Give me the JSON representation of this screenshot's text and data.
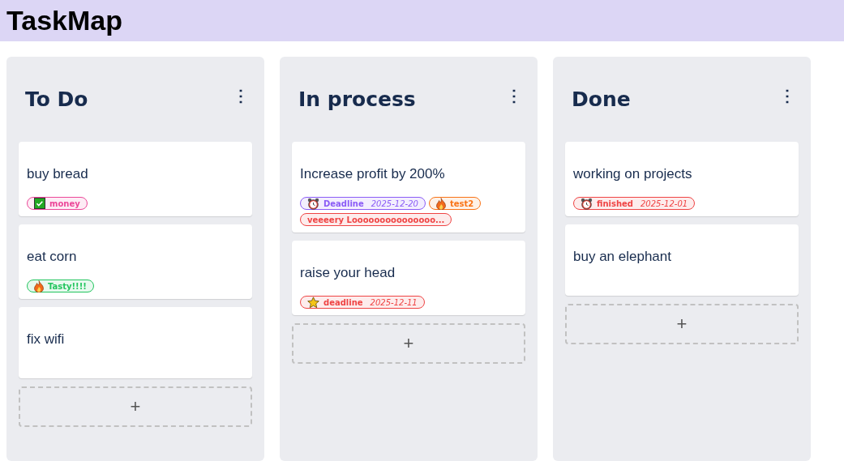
{
  "app": {
    "title": "TaskMap"
  },
  "columns": [
    {
      "title": "To Do",
      "menu": "⋮",
      "add": "+",
      "cards": [
        {
          "title": "buy bread",
          "tags": [
            {
              "kind": "check",
              "label": "money",
              "color": "#ec4899"
            }
          ]
        },
        {
          "title": "eat corn",
          "tags": [
            {
              "kind": "fire",
              "label": "Tasty!!!!",
              "color": "#22c55e"
            }
          ]
        },
        {
          "title": "fix wifi"
        }
      ]
    },
    {
      "title": "In process",
      "menu": "⋮",
      "add": "+",
      "cards": [
        {
          "title": "Increase profit by 200%",
          "tags": [
            {
              "kind": "clock",
              "label": "Deadline",
              "date": "2025-12-20",
              "color": "#8b5cf6"
            },
            {
              "kind": "fire",
              "label": "test2",
              "color": "#f97316"
            },
            {
              "label": "veeeery Looooooooooooooo...",
              "color": "#ef4444"
            }
          ]
        },
        {
          "title": "raise your head",
          "tags": [
            {
              "kind": "star",
              "label": "deadline",
              "date": "2025-12-11",
              "color": "#ef4444"
            }
          ]
        }
      ]
    },
    {
      "title": "Done",
      "menu": "⋮",
      "add": "+",
      "cards": [
        {
          "title": "working on projects",
          "tags": [
            {
              "kind": "clock",
              "label": "finished",
              "date": "2025-12-01",
              "color": "#ef4444"
            }
          ]
        },
        {
          "title": "buy an elephant"
        }
      ]
    }
  ]
}
